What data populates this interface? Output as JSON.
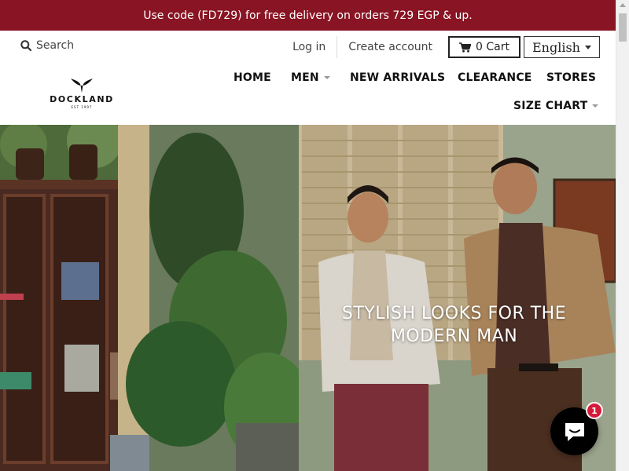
{
  "announcement": "Use code (FD729) for free delivery on orders 729 EGP & up.",
  "header": {
    "search_label": "Search",
    "login": "Log in",
    "create_account": "Create account",
    "cart_label": "0 Cart",
    "language": "English",
    "logo_text": "DOCKLAND",
    "logo_est": "EST 1997"
  },
  "nav": {
    "home": "HOME",
    "men": "MEN",
    "new_arrivals": "NEW ARRIVALS",
    "clearance": "CLEARANCE",
    "stores": "STORES",
    "size_chart": "SIZE CHART"
  },
  "hero": {
    "line1": "STYLISH LOOKS FOR THE",
    "line2": "MODERN MAN"
  },
  "chat": {
    "badge_count": "1"
  },
  "colors": {
    "announcement_bg": "#891423",
    "badge": "#d61b3a"
  }
}
